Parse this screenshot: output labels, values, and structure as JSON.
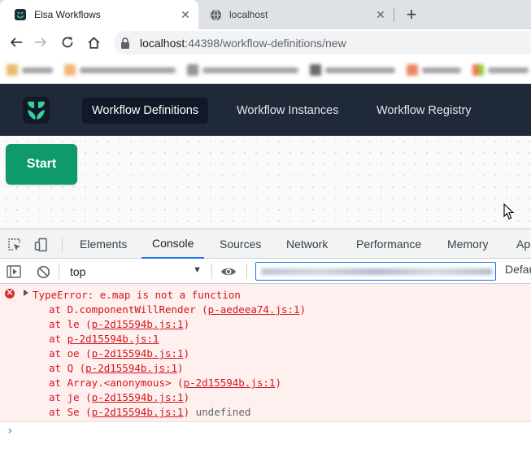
{
  "browser": {
    "tabs": [
      {
        "title": "Elsa Workflows",
        "active": true,
        "favicon": "elsa-favicon-icon"
      },
      {
        "title": "localhost",
        "active": false,
        "favicon": "globe-icon"
      }
    ],
    "new_tab_label": "+",
    "url_host": "localhost",
    "url_path": ":44398/workflow-definitions/new"
  },
  "app": {
    "nav": [
      {
        "label": "Workflow Definitions",
        "active": true
      },
      {
        "label": "Workflow Instances",
        "active": false
      },
      {
        "label": "Workflow Registry",
        "active": false
      }
    ],
    "start_label": "Start",
    "colors": {
      "header_bg": "#1f2937",
      "start_green": "#0e9a6c"
    }
  },
  "devtools": {
    "tabs": [
      {
        "label": "Elements",
        "active": false
      },
      {
        "label": "Console",
        "active": true
      },
      {
        "label": "Sources",
        "active": false
      },
      {
        "label": "Network",
        "active": false
      },
      {
        "label": "Performance",
        "active": false
      },
      {
        "label": "Memory",
        "active": false
      },
      {
        "label": "Ap",
        "active": false
      }
    ],
    "context": "top",
    "levels_label": "Defau",
    "error": {
      "message": "TypeError: e.map is not a function",
      "stack": [
        {
          "prefix": "at D.componentWillRender (",
          "link": "p-aedeea74.js:1",
          "suffix": ")"
        },
        {
          "prefix": "at le (",
          "link": "p-2d15594b.js:1",
          "suffix": ")"
        },
        {
          "prefix": "at ",
          "link": "p-2d15594b.js:1",
          "suffix": ""
        },
        {
          "prefix": "at oe (",
          "link": "p-2d15594b.js:1",
          "suffix": ")"
        },
        {
          "prefix": "at Q (",
          "link": "p-2d15594b.js:1",
          "suffix": ")"
        },
        {
          "prefix": "at Array.<anonymous> (",
          "link": "p-2d15594b.js:1",
          "suffix": ")"
        },
        {
          "prefix": "at je (",
          "link": "p-2d15594b.js:1",
          "suffix": ")"
        },
        {
          "prefix": "at Se (",
          "link": "p-2d15594b.js:1",
          "suffix": ")",
          "tail": " undefined"
        }
      ]
    },
    "prompt_symbol": "›"
  }
}
